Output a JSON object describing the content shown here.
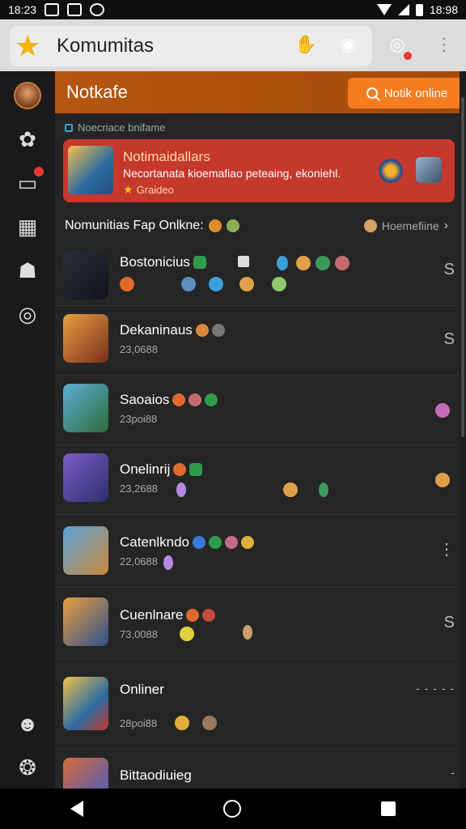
{
  "status_bar": {
    "time": "18:23",
    "time_right": "18:98"
  },
  "app_bar": {
    "title": "Komumitas"
  },
  "header": {
    "title": "Notkafe",
    "button_label": "Notik online"
  },
  "section_label": "Noecriace bnifame",
  "featured": {
    "title": "Notimaidallars",
    "description": "Necortanata kioemafiao peteaing, ekoniehl.",
    "sub": "Graideo"
  },
  "list": {
    "header": "Nomunitias Fap Onlkne:",
    "filter": "Hoemefiine",
    "rows": [
      {
        "title": "Bostonicius",
        "sub": "",
        "trail": "S"
      },
      {
        "title": "Dekaninaus",
        "sub": "23,0688",
        "trail": "S"
      },
      {
        "title": "Saoaios",
        "sub": "23poi88",
        "trail": ""
      },
      {
        "title": "Onelinrij",
        "sub": "23,2688",
        "trail": ""
      },
      {
        "title": "Catenlkndo",
        "sub": "22,0688",
        "trail": "⋮"
      },
      {
        "title": "Cuenlnare",
        "sub": "73,0088",
        "trail": "S"
      },
      {
        "title": "Onliner",
        "sub": "28poi88",
        "trail": "- - - - -"
      },
      {
        "title": "Bittaodiuieg",
        "sub": "",
        "trail": "-"
      }
    ]
  },
  "icons": {
    "app_logo": "star-logo-icon",
    "sidebar": [
      "avatar",
      "gear-icon",
      "chat-icon",
      "grid-icon",
      "people-icon",
      "power-icon",
      "group-icon",
      "settings-icon"
    ]
  },
  "colors": {
    "accent": "#f57c1f",
    "header": "#b4560f",
    "featured": "#c5382c"
  }
}
